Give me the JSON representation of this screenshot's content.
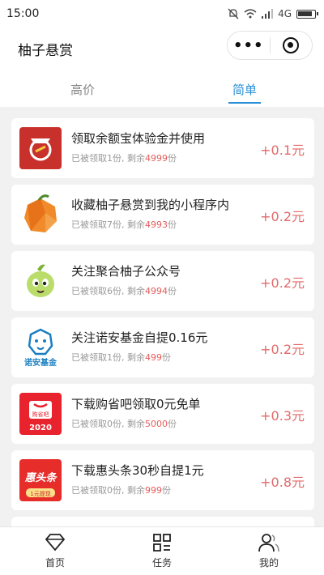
{
  "status": {
    "time": "15:00",
    "network": "4G"
  },
  "header": {
    "title": "柚子悬赏",
    "more_icon": "more-dots-icon",
    "target_icon": "target-icon"
  },
  "tabs": [
    {
      "label": "高价",
      "active": false
    },
    {
      "label": "简单",
      "active": true
    }
  ],
  "tasks": [
    {
      "name": "领取余额宝体验金并使用",
      "claimed": "已被领取1份, 剩余",
      "remain": "4999",
      "unit": "份",
      "reward": "+0.1元"
    },
    {
      "name": "收藏柚子悬赏到我的小程序内",
      "claimed": "已被领取7份, 剩余",
      "remain": "4993",
      "unit": "份",
      "reward": "+0.2元"
    },
    {
      "name": "关注聚合柚子公众号",
      "claimed": "已被领取6份, 剩余",
      "remain": "4994",
      "unit": "份",
      "reward": "+0.2元"
    },
    {
      "name": "关注诺安基金自提0.16元",
      "claimed": "已被领取1份, 剩余",
      "remain": "499",
      "unit": "份",
      "reward": "+0.2元",
      "logo_text": "诺安基金"
    },
    {
      "name": "下载购省吧领取0元免单",
      "claimed": "已被领取0份, 剩余",
      "remain": "5000",
      "unit": "份",
      "reward": "+0.3元",
      "logo_text": "购省吧",
      "logo_year": "2020"
    },
    {
      "name": "下载惠头条30秒自提1元",
      "claimed": "已被领取0份, 剩余",
      "remain": "999",
      "unit": "份",
      "reward": "+0.8元",
      "logo_text": "惠头条",
      "logo_sub": "1元提现"
    }
  ],
  "nav": [
    {
      "label": "首页",
      "icon": "diamond-icon"
    },
    {
      "label": "任务",
      "icon": "grid-icon"
    },
    {
      "label": "我的",
      "icon": "user-icon"
    }
  ],
  "colors": {
    "accent": "#2a8fd6",
    "reward": "#e36a6a",
    "remain": "#e55b5b"
  }
}
